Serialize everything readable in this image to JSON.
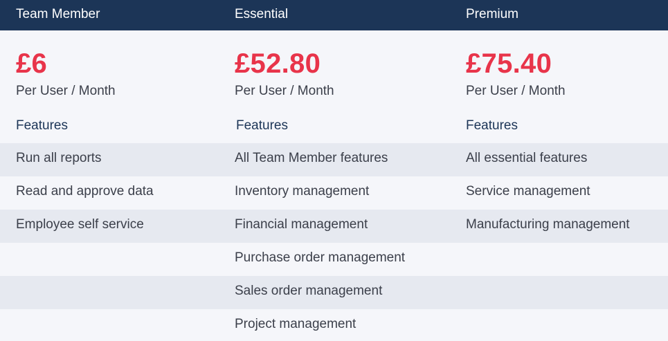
{
  "plans": [
    {
      "name": "Team Member",
      "price": "£6",
      "unit": "Per User / Month",
      "features_heading": "Features",
      "features": [
        "Run all reports",
        "Read and approve data",
        "Employee self service"
      ]
    },
    {
      "name": "Essential",
      "price": "£52.80",
      "unit": "Per User / Month",
      "features_heading": "Features",
      "features": [
        "All Team Member features",
        "Inventory management",
        "Financial management",
        "Purchase order management",
        "Sales order management",
        "Project management"
      ]
    },
    {
      "name": "Premium",
      "price": "£75.40",
      "unit": "Per User / Month",
      "features_heading": "Features",
      "features": [
        "All essential features",
        "Service management",
        "Manufacturing management"
      ]
    }
  ],
  "colors": {
    "header_bg": "#1c3557",
    "price": "#e8344a",
    "band": "#e6e9f0",
    "page_bg": "#f5f6fa"
  }
}
